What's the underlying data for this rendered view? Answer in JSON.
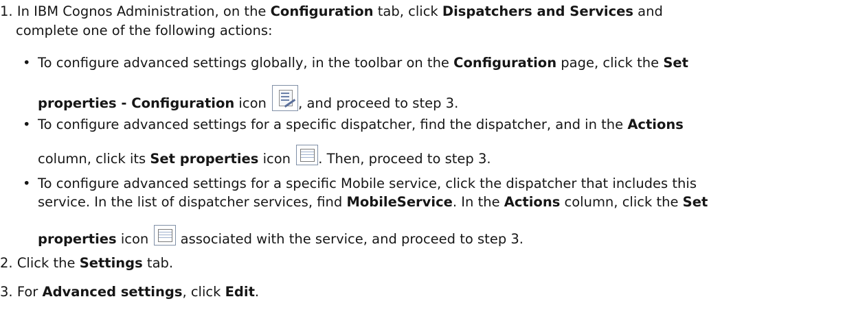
{
  "steps": {
    "s1": {
      "num": "1.",
      "l1_a": "In IBM Cognos Administration, on the ",
      "l1_b": "Configuration",
      "l1_c": " tab, click ",
      "l1_d": "Dispatchers and Services",
      "l1_e": " and",
      "l2": "complete one of the following actions:"
    },
    "b1": {
      "mark": "•",
      "l1_a": "To configure advanced settings globally, in the toolbar on the ",
      "l1_b": "Configuration",
      "l1_c": " page, click the ",
      "l1_d": "Set",
      "l2_a": "properties - Configuration",
      "l2_b": " icon ",
      "l2_c": ", and proceed to step 3.",
      "icon": "set-properties-configuration-icon"
    },
    "b2": {
      "mark": "•",
      "l1_a": "To configure advanced settings for a specific dispatcher, find the dispatcher, and in the ",
      "l1_b": "Actions",
      "l2_a": "column, click its ",
      "l2_b": "Set properties",
      "l2_c": " icon ",
      "l2_d": ". Then, proceed to step 3.",
      "icon": "set-properties-icon"
    },
    "b3": {
      "mark": "•",
      "l1": "To configure advanced settings for a specific Mobile service, click the dispatcher that includes this",
      "l2_a": "service. In the list of dispatcher services, find ",
      "l2_b": "MobileService",
      "l2_c": ". In the ",
      "l2_d": "Actions",
      "l2_e": " column, click the ",
      "l2_f": "Set",
      "l3_a": "properties",
      "l3_b": " icon ",
      "l3_c": " associated with the service, and proceed to step 3.",
      "icon": "set-properties-icon"
    },
    "s2": {
      "num": "2.",
      "a": "Click the ",
      "b": "Settings",
      "c": " tab."
    },
    "s3": {
      "num": "3.",
      "a": "For ",
      "b": "Advanced settings",
      "c": ", click ",
      "d": "Edit",
      "e": "."
    }
  }
}
